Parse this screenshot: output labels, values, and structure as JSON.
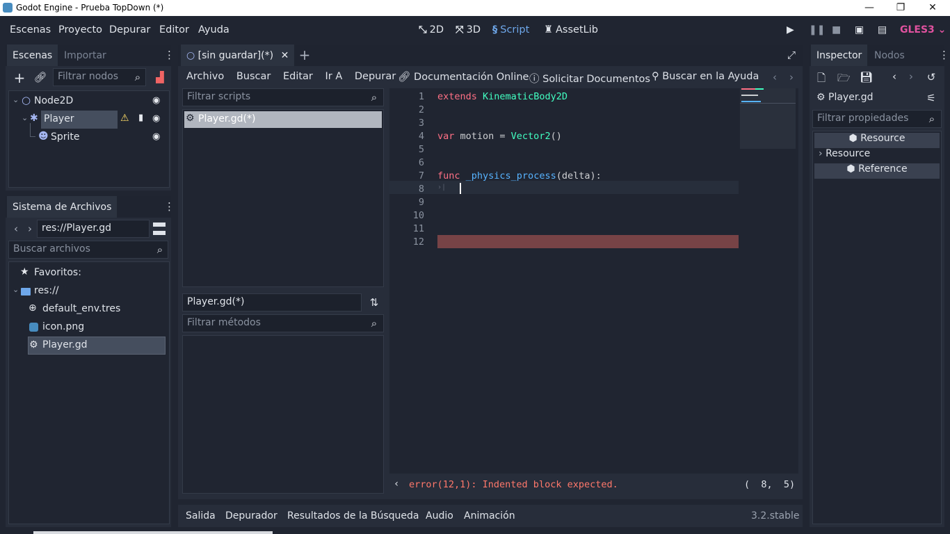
{
  "window": {
    "title": "Godot Engine - Prueba TopDown (*)",
    "minimize": "—",
    "restore": "❐",
    "close": "✕"
  },
  "menu": {
    "items": [
      "Escenas",
      "Proyecto",
      "Depurar",
      "Editor",
      "Ayuda"
    ]
  },
  "modes": {
    "m2d": "2D",
    "m3d": "3D",
    "script": "Script",
    "assetlib": "AssetLib"
  },
  "renderer": "GLES3 ⌄",
  "scene_panel": {
    "tab_active": "Escenas",
    "tab_inactive": "Importar",
    "filter_placeholder": "Filtrar nodos",
    "nodes": [
      {
        "label": "Node2D"
      },
      {
        "label": "Player"
      },
      {
        "label": "Sprite"
      }
    ]
  },
  "fs_panel": {
    "tab": "Sistema de Archivos",
    "path": "res://Player.gd",
    "search_placeholder": "Buscar archivos",
    "items": [
      {
        "label": "Favoritos:"
      },
      {
        "label": "res://"
      },
      {
        "label": "default_env.tres"
      },
      {
        "label": "icon.png"
      },
      {
        "label": "Player.gd"
      }
    ]
  },
  "script_editor": {
    "tab_label": "[sin guardar](*)",
    "menu": [
      "Archivo",
      "Buscar",
      "Editar",
      "Ir A",
      "Depurar"
    ],
    "doc_online": "Documentación Online",
    "request_docs": "Solicitar Documentos",
    "search_help": "Buscar en la Ayuda",
    "filter_scripts_placeholder": "Filtrar scripts",
    "scripts": [
      "Player.gd(*)"
    ],
    "methods_title": "Player.gd(*)",
    "filter_methods_placeholder": "Filtrar métodos",
    "line_numbers": [
      "1",
      "2",
      "3",
      "4",
      "5",
      "6",
      "7",
      "8",
      "9",
      "10",
      "11",
      "12"
    ],
    "code": {
      "l1_kw": "extends",
      "l1_type": "KinematicBody2D",
      "l4_kw": "var",
      "l4_mid": " motion = ",
      "l4_type": "Vector2",
      "l4_end": "()",
      "l7_kw": "func",
      "l7_fn": "_physics_process",
      "l7_end": "(delta):",
      "l8_tab": "›|"
    },
    "error": "error(12,1): Indented block expected.",
    "cursor_pos": "(  8,  5)"
  },
  "inspector": {
    "tab_active": "Inspector",
    "tab_inactive": "Nodos",
    "object": "Player.gd",
    "filter_placeholder": "Filtrar propiedades",
    "sections": [
      "Resource",
      "Resource",
      "Reference"
    ]
  },
  "bottom_panel": {
    "tabs": [
      "Salida",
      "Depurador",
      "Resultados de la Búsqueda",
      "Audio",
      "Animación"
    ],
    "version": "3.2.stable"
  }
}
